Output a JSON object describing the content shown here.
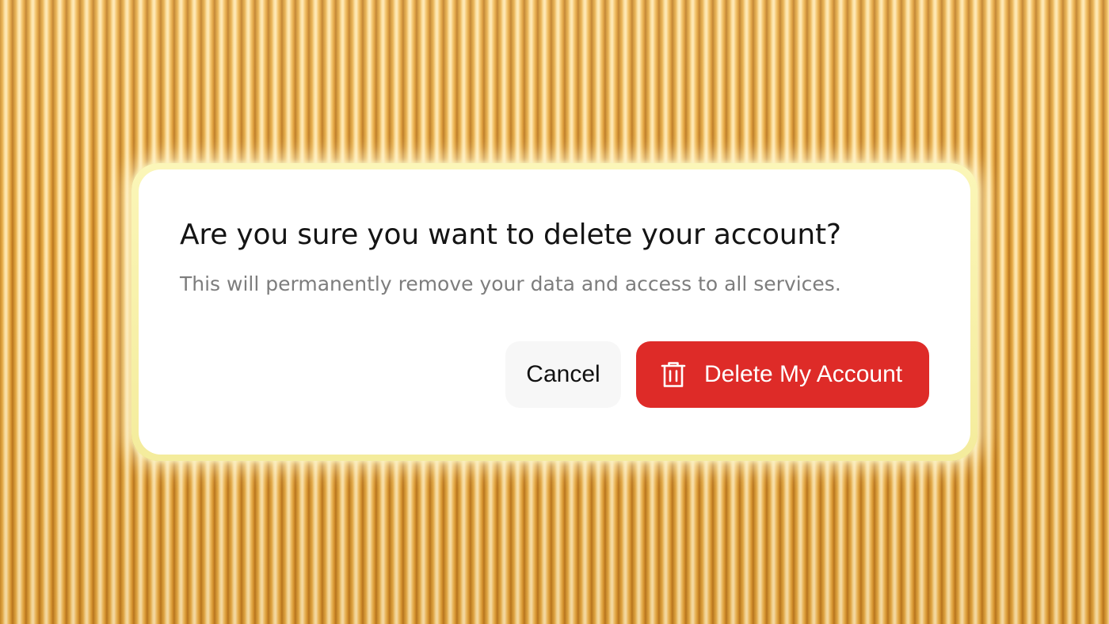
{
  "dialog": {
    "title": "Are you sure you want to delete your account?",
    "message": "This will permanently remove your data and access to all services.",
    "cancel_label": "Cancel",
    "delete_label": "Delete My Account",
    "delete_icon": "trash-icon"
  },
  "colors": {
    "danger": "#de2b28",
    "cancel_bg": "#f7f7f7",
    "title": "#141414",
    "message": "#7d7d7d",
    "dialog_bg": "#ffffff",
    "glow_border": "#f4ec9c",
    "backdrop": "#e7ac48"
  }
}
